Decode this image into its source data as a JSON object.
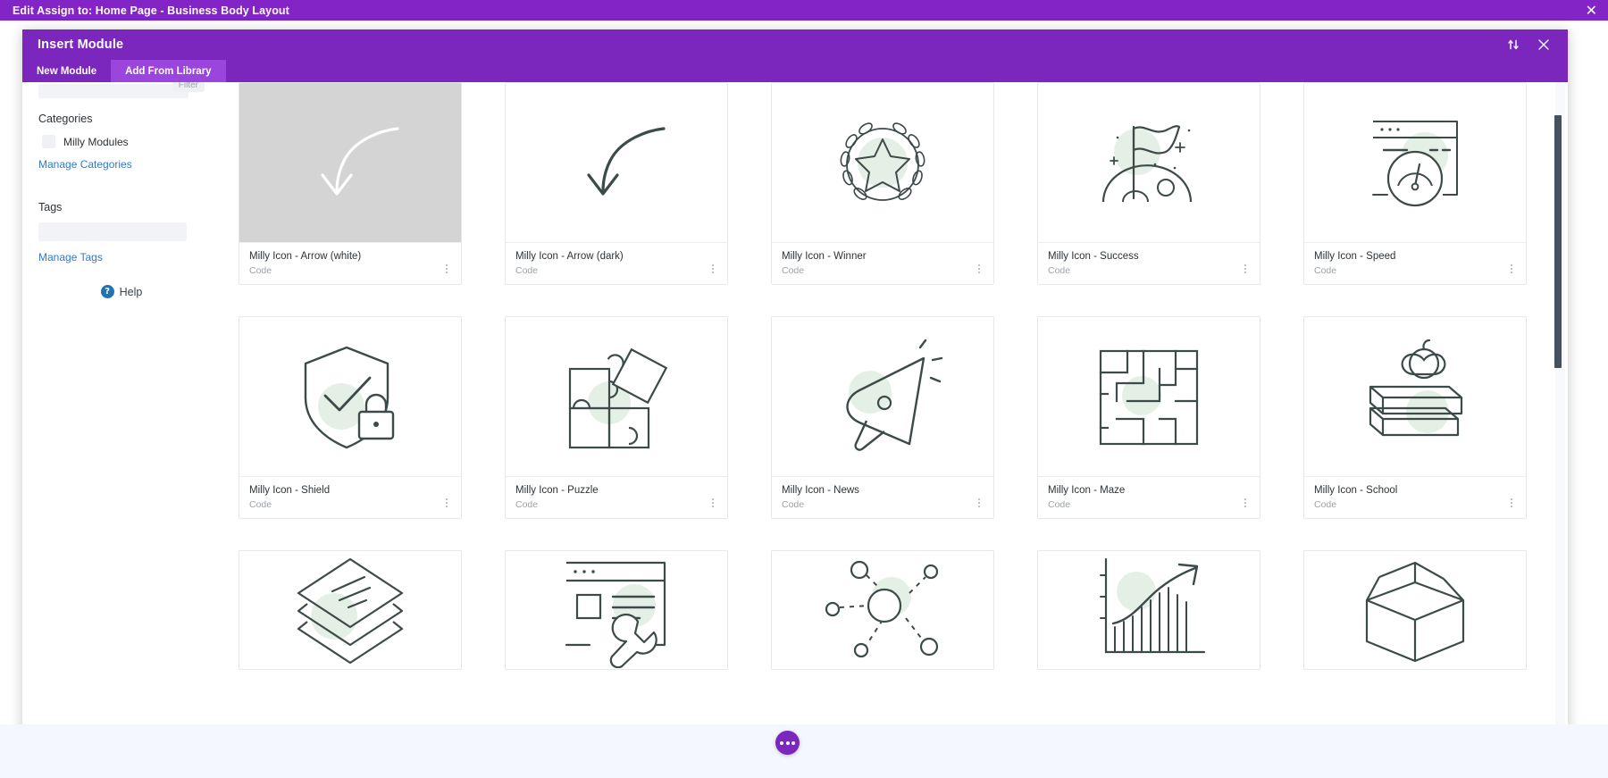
{
  "admin_bar": {
    "title": "Edit Assign to: Home Page - Business Body Layout",
    "close_icon": "close-icon",
    "close_glyph": "✕",
    "background": "#8224c6"
  },
  "modal": {
    "title": "Insert Module",
    "background": "#7b27bd",
    "header_icons": [
      {
        "name": "sort-order-icon",
        "glyph": "⇅"
      },
      {
        "name": "close-icon",
        "glyph": "✕"
      }
    ],
    "tabs": [
      {
        "label": "New Module",
        "active": false
      },
      {
        "label": "Add From Library",
        "active": true
      }
    ]
  },
  "sidebar": {
    "filter_label": "Filter",
    "search_placeholder": "",
    "categories_heading": "Categories",
    "categories": [
      {
        "label": "Milly Modules",
        "checked": false
      }
    ],
    "manage_categories_link": "Manage Categories",
    "tags_heading": "Tags",
    "tags_value": "",
    "manage_tags_link": "Manage Tags",
    "help_label": "Help",
    "help_badge": "?"
  },
  "library": {
    "subtitle": "Code",
    "accent_green": "#e4f0e6",
    "stroke": "#3d4a4a",
    "rows": [
      {
        "clipped": false,
        "items": [
          {
            "title": "Milly Icon - Arrow (white)",
            "subtitle": "Code",
            "icon": "arrow-curved-white-icon",
            "thumb_bg": "grey"
          },
          {
            "title": "Milly Icon - Arrow (dark)",
            "subtitle": "Code",
            "icon": "arrow-curved-dark-icon",
            "thumb_bg": "white"
          },
          {
            "title": "Milly Icon - Winner",
            "subtitle": "Code",
            "icon": "laurel-star-icon",
            "thumb_bg": "white"
          },
          {
            "title": "Milly Icon - Success",
            "subtitle": "Code",
            "icon": "flag-planet-icon",
            "thumb_bg": "white"
          },
          {
            "title": "Milly Icon - Speed",
            "subtitle": "Code",
            "icon": "browser-speedometer-icon",
            "thumb_bg": "white"
          }
        ]
      },
      {
        "clipped": false,
        "items": [
          {
            "title": "Milly Icon - Shield",
            "subtitle": "Code",
            "icon": "shield-lock-check-icon",
            "thumb_bg": "white"
          },
          {
            "title": "Milly Icon - Puzzle",
            "subtitle": "Code",
            "icon": "puzzle-pieces-icon",
            "thumb_bg": "white"
          },
          {
            "title": "Milly Icon - News",
            "subtitle": "Code",
            "icon": "megaphone-icon",
            "thumb_bg": "white"
          },
          {
            "title": "Milly Icon - Maze",
            "subtitle": "Code",
            "icon": "maze-icon",
            "thumb_bg": "white"
          },
          {
            "title": "Milly Icon - School",
            "subtitle": "Code",
            "icon": "apple-books-icon",
            "thumb_bg": "white"
          }
        ]
      },
      {
        "clipped": true,
        "items": [
          {
            "title": "",
            "subtitle": "",
            "icon": "layers-icon",
            "thumb_bg": "white"
          },
          {
            "title": "",
            "subtitle": "",
            "icon": "browser-wrench-icon",
            "thumb_bg": "white"
          },
          {
            "title": "",
            "subtitle": "",
            "icon": "network-nodes-icon",
            "thumb_bg": "white"
          },
          {
            "title": "",
            "subtitle": "",
            "icon": "growth-chart-icon",
            "thumb_bg": "white"
          },
          {
            "title": "",
            "subtitle": "",
            "icon": "open-box-icon",
            "thumb_bg": "white"
          }
        ]
      }
    ]
  },
  "footer": {
    "fab_name": "more-options-fab",
    "fab_color": "#7b27bd"
  }
}
